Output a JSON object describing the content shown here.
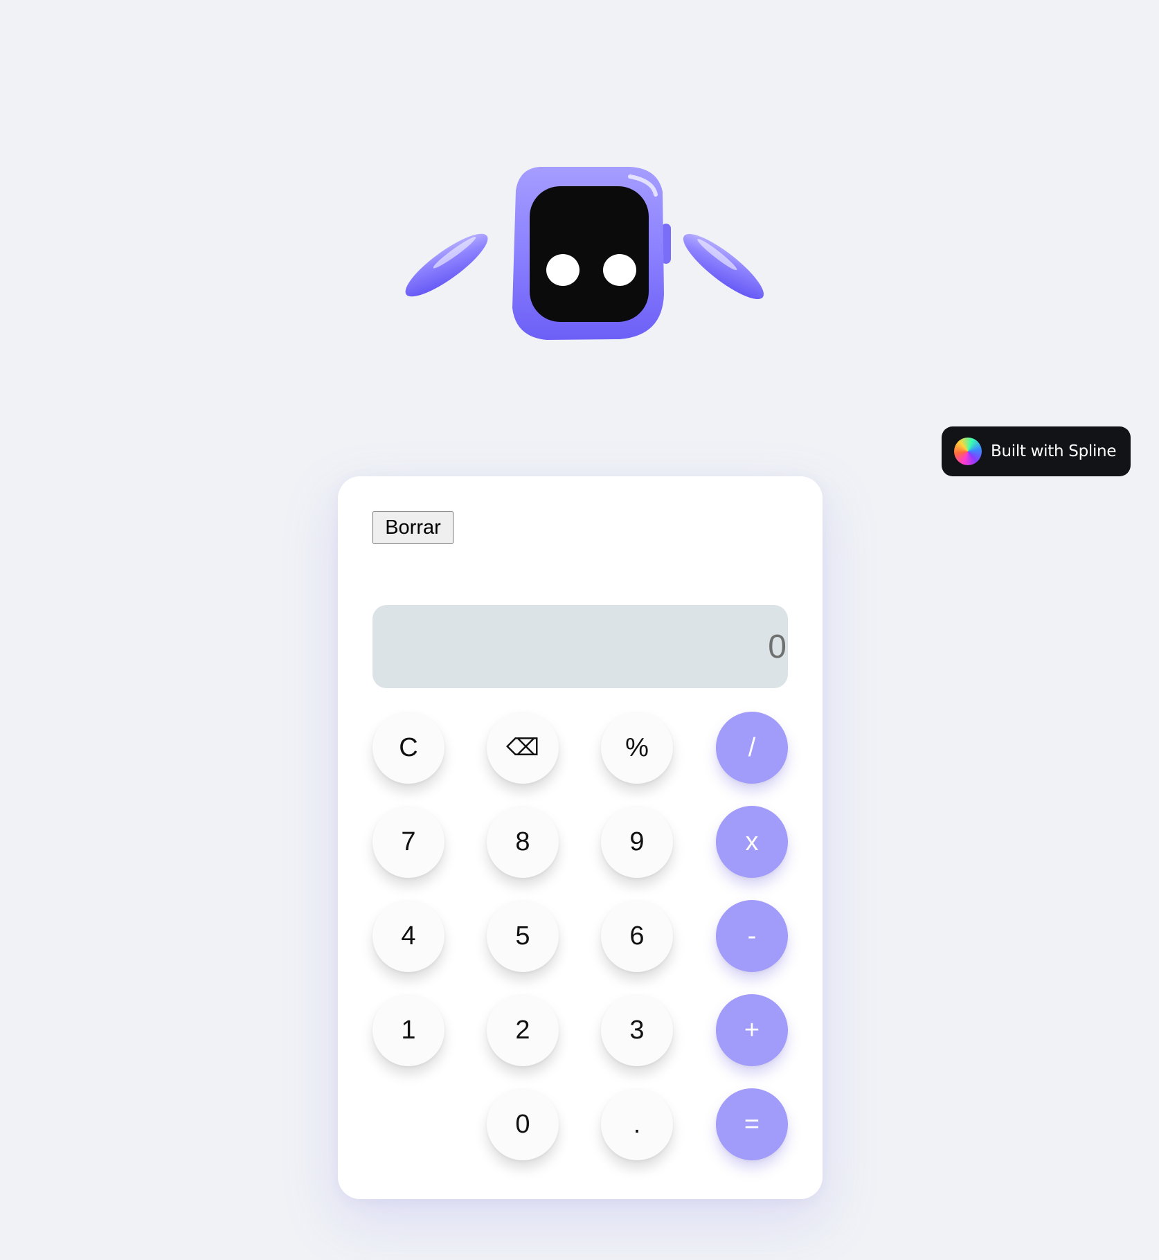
{
  "badge": {
    "label": "Built with Spline",
    "icon": "spline-logo-icon"
  },
  "calculator": {
    "clear_all_label": "Borrar",
    "display_value": "0",
    "keys": {
      "clear": "C",
      "backspace": "⌫",
      "percent": "%",
      "divide": "/",
      "seven": "7",
      "eight": "8",
      "nine": "9",
      "multiply": "x",
      "four": "4",
      "five": "5",
      "six": "6",
      "subtract": "-",
      "one": "1",
      "two": "2",
      "three": "3",
      "add": "+",
      "zero": "0",
      "decimal": ".",
      "equals": "="
    }
  },
  "colors": {
    "background": "#f0f2f6",
    "operator_key": "#a19bf9",
    "number_key": "#fbfbfb",
    "display": "#dce3e6",
    "robot_body": "#8f84ff",
    "robot_face": "#0b0b0c",
    "badge": "#121317"
  }
}
